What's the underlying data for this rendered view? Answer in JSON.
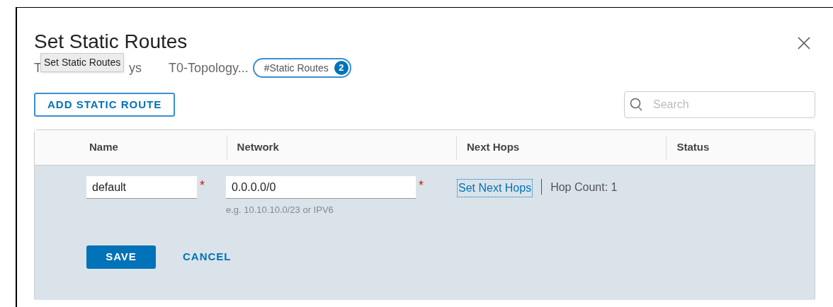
{
  "dialog": {
    "title": "Set Static Routes"
  },
  "breadcrumb": {
    "parts": [
      "T",
      "ys"
    ],
    "tooltip": "Set Static Routes",
    "current": "T0-Topology...",
    "pill": {
      "label": "#Static Routes",
      "count": "2"
    }
  },
  "toolbar": {
    "add_button": "ADD STATIC ROUTE",
    "search": {
      "placeholder": "Search"
    }
  },
  "table": {
    "columns": [
      "Name",
      "Network",
      "Next Hops",
      "Status"
    ],
    "edit_row": {
      "name": "default",
      "name_mark": "*",
      "network": "0.0.0.0/0",
      "network_mark": "*",
      "network_hint": "e.g. 10.10.10.0/23 or IPV6",
      "next_hops_link": "Set Next Hops",
      "hop_count": "Hop Count: 1",
      "save": "SAVE",
      "cancel": "CANCEL"
    }
  }
}
